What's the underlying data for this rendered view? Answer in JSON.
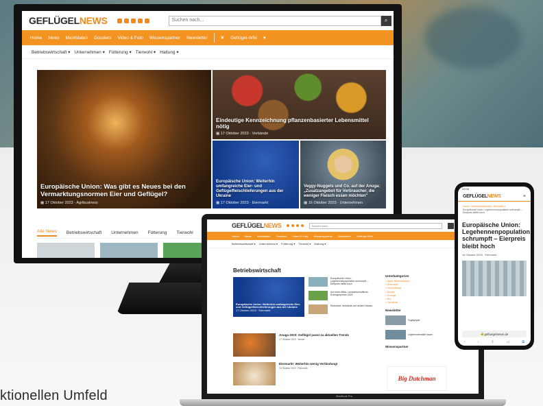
{
  "bottom_text": "ktionellen Umfeld",
  "monitor": {
    "logo_a": "GEFLÜGEL",
    "logo_b": "NEWS",
    "search_placeholder": "Suchen nach...",
    "search_icon": "search-icon",
    "nav": [
      "Home",
      "News",
      "Marktdaten",
      "Dossiers",
      "Video & Foto",
      "Wissenspartner",
      "Newsletter"
    ],
    "wiki": "Geflügel-Wiki",
    "subnav": [
      "Betriebswirtschaft ▾",
      "Unternehmen ▾",
      "Fütterung ▾",
      "Tierwohl ▾",
      "Haltung ▾"
    ],
    "tiles": [
      {
        "title": "Europäische Union: Was gibt es Neues bei den Vermarktungsnormen Eier und Geflügel?",
        "date": "17 Oktober 2023",
        "tag": "Agribusiness"
      },
      {
        "title": "Eindeutige Kennzeichnung pflanzenbasierter Lebensmittel nötig",
        "date": "17 Oktober 2023",
        "tag": "Verbände"
      },
      {
        "title": "Europäische Union: Weiterhin umfangreiche Eier- und Geflügelfleischlieferungen aus der Ukraine",
        "date": "17 Oktober 2023",
        "tag": "Eiermarkt"
      },
      {
        "title": "Veggy-Nuggets und Co. auf der Anuga: „Zusatzangebot für Verbraucher, die weniger Fleisch essen möchten\"",
        "date": "16 Oktober 2023",
        "tag": "Unternehmen"
      }
    ],
    "tabs": [
      "Alle News",
      "Betriebswirtschaft",
      "Unternehmen",
      "Fütterung",
      "Tierwohl"
    ]
  },
  "laptop": {
    "logo_a": "GEFLÜGEL",
    "logo_b": "NEWS",
    "search_placeholder": "Suchen nach...",
    "nav": [
      "Home",
      "News",
      "Marktdaten",
      "Dossiers",
      "Video & Foto",
      "Wissenspartner",
      "Newsletter",
      "Geflügel-Wiki"
    ],
    "subnav": [
      "Betriebswirtschaft ▾",
      "Unternehmen ▾",
      "Fütterung ▾",
      "Tierwohl ▾",
      "Haltung ▾"
    ],
    "heading": "Betriebswirtschaft",
    "feature_title": "Europäische Union: Weiterhin umfangreiche Eier- und Geflügelfleischlieferungen aus der Ukraine",
    "feature_meta": "17 Oktober 2023 · Eiermarkt",
    "list": [
      "Europäische Union: Legehennenpopulation schrumpft – Eierpreis bleibt hoch",
      "Auf einen Blick: Landwirtschaftliche Erzeugerpreise 2023",
      "Eiermarkt: Verbände auf hohem Niveau"
    ],
    "rows": [
      {
        "title": "Anuga 2023: Geflügel passt zu aktuellen Trends",
        "meta": "17 Oktober 2023 · Messe"
      },
      {
        "title": "Eiermarkt: Weiterhin wenig Verbindung!",
        "meta": "15 Oktober 2023 · Eiermarkt"
      }
    ],
    "side_head": "Unterkategorien",
    "side_items": [
      "» Agrar-Betriebsfläche",
      "» Eiermarkt",
      "» Schlachtung",
      "» Absatz",
      "» Energie",
      "» Bio",
      "» Verbände"
    ],
    "side_head2": "Newsletter",
    "ads": [
      "Vogelgrippe",
      "Legehennenställe bauen"
    ],
    "partner_head": "Wissenspartner",
    "partner_logo": "Big Dutchman",
    "base_label": "MacBook Pro"
  },
  "phone": {
    "time": "09:08",
    "logo_a": "GEFLÜGEL",
    "logo_b": "NEWS",
    "crumb": "Home » Betriebswirtschaft » Eiermarkt »",
    "crumb2": "Europäische Union: Legehennenpopulation schrumpft – Eierpreis bleibt hoch",
    "title": "Europäische Union: Legehennenpopulation schrumpft – Eierpreis bleibt hoch",
    "meta": "16 Oktober 2023 · Eiermarkt",
    "url": "gefluegelnews.de"
  },
  "colors": {
    "accent": "#f39322"
  }
}
